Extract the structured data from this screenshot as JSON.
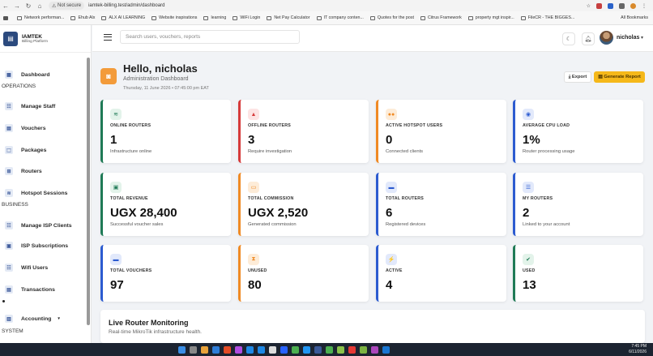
{
  "browser": {
    "security_label": "Not secure",
    "url": "iamtek-billing.test/admin/dashboard",
    "bookmarks": [
      "Network performan...",
      "Ehub Alx",
      "ALX AI LEARNING",
      "Website inspirations",
      "learning",
      "WiFi Login",
      "Net Pay Calculator",
      "IT company conten...",
      "Quotes for the post",
      "Citrus Framework",
      "property mgt inspir...",
      "FileCR - THE BIGGES..."
    ],
    "all_bookmarks": "All Bookmarks"
  },
  "brand": {
    "name": "IAMTEK",
    "subtitle": "Billing Platform"
  },
  "sidebar": {
    "items": [
      {
        "label": "Dashboard",
        "icon": "dashboard-icon"
      },
      {
        "label": "Manage Staff",
        "icon": "staff-icon"
      },
      {
        "label": "Vouchers",
        "icon": "voucher-icon"
      },
      {
        "label": "Packages",
        "icon": "package-icon"
      },
      {
        "label": "Routers",
        "icon": "router-icon"
      },
      {
        "label": "Hotspot Sessions",
        "icon": "wifi-icon"
      },
      {
        "label": "Manage ISP Clients",
        "icon": "clients-icon"
      },
      {
        "label": "ISP Subscriptions",
        "icon": "subscription-icon"
      },
      {
        "label": "Wifi Users",
        "icon": "users-icon"
      },
      {
        "label": "Transactions",
        "icon": "transactions-icon"
      },
      {
        "label": "Accounting",
        "icon": "accounting-icon"
      }
    ],
    "sections": [
      "OPERATIONS",
      "BUSINESS",
      "SYSTEM"
    ]
  },
  "topbar": {
    "search_placeholder": "Search users, vouchers, reports",
    "username": "nicholas"
  },
  "header": {
    "greeting": "Hello, nicholas",
    "subtitle": "Administration Dashboard",
    "date": "Thursday, 11 June 2026 • 07:45:00 pm EAT",
    "export_label": "Export",
    "generate_label": "Generate Report"
  },
  "cards": [
    {
      "label": "ONLINE ROUTERS",
      "value": "1",
      "note": "Infrastructure online",
      "accent": "#1f7a56",
      "icon_bg": "#e3f3ea",
      "icon_color": "#1f7a56",
      "icon": "wifi-icon",
      "glyph": "≋"
    },
    {
      "label": "OFFLINE ROUTERS",
      "value": "3",
      "note": "Require investigation",
      "accent": "#d63b3b",
      "icon_bg": "#fde4e4",
      "icon_color": "#d63b3b",
      "icon": "warning-icon",
      "glyph": "▲"
    },
    {
      "label": "ACTIVE HOTSPOT USERS",
      "value": "0",
      "note": "Connected clients",
      "accent": "#f08a24",
      "icon_bg": "#fdecd8",
      "icon_color": "#f08a24",
      "icon": "users-icon",
      "glyph": "●●"
    },
    {
      "label": "AVERAGE CPU LOAD",
      "value": "1%",
      "note": "Router processing usage",
      "accent": "#2c5bd0",
      "icon_bg": "#e2e9fb",
      "icon_color": "#2c5bd0",
      "icon": "cpu-icon",
      "glyph": "◉"
    },
    {
      "label": "TOTAL REVENUE",
      "value": "UGX 28,400",
      "note": "Successful voucher sales",
      "accent": "#1f7a56",
      "icon_bg": "#e3f3ea",
      "icon_color": "#1f7a56",
      "icon": "money-icon",
      "glyph": "▣"
    },
    {
      "label": "TOTAL COMMISSION",
      "value": "UGX 2,520",
      "note": "Generated commission",
      "accent": "#f08a24",
      "icon_bg": "#fdecd8",
      "icon_color": "#f08a24",
      "icon": "wallet-icon",
      "glyph": "▭"
    },
    {
      "label": "TOTAL ROUTERS",
      "value": "6",
      "note": "Registered devices",
      "accent": "#2c5bd0",
      "icon_bg": "#e2e9fb",
      "icon_color": "#2c5bd0",
      "icon": "router-icon",
      "glyph": "▬"
    },
    {
      "label": "MY ROUTERS",
      "value": "2",
      "note": "Linked to your account",
      "accent": "#2c5bd0",
      "icon_bg": "#e2e9fb",
      "icon_color": "#2c5bd0",
      "icon": "server-icon",
      "glyph": "☰"
    },
    {
      "label": "TOTAL VOUCHERS",
      "value": "97",
      "note": "",
      "accent": "#2c5bd0",
      "icon_bg": "#e2e9fb",
      "icon_color": "#2c5bd0",
      "icon": "ticket-icon",
      "glyph": "▬"
    },
    {
      "label": "UNUSED",
      "value": "80",
      "note": "",
      "accent": "#f08a24",
      "icon_bg": "#fdecd8",
      "icon_color": "#f08a24",
      "icon": "hourglass-icon",
      "glyph": "⧗"
    },
    {
      "label": "ACTIVE",
      "value": "4",
      "note": "",
      "accent": "#2c5bd0",
      "icon_bg": "#e2e9fb",
      "icon_color": "#2c5bd0",
      "icon": "bolt-icon",
      "glyph": "⚡"
    },
    {
      "label": "USED",
      "value": "13",
      "note": "",
      "accent": "#1f7a56",
      "icon_bg": "#e3f3ea",
      "icon_color": "#1f7a56",
      "icon": "check-icon",
      "glyph": "✔"
    }
  ],
  "live": {
    "title": "Live Router Monitoring",
    "subtitle": "Real-time MikroTik infrastructure health."
  },
  "taskbar": {
    "time": "7:45 PM",
    "date": "6/11/2026"
  }
}
